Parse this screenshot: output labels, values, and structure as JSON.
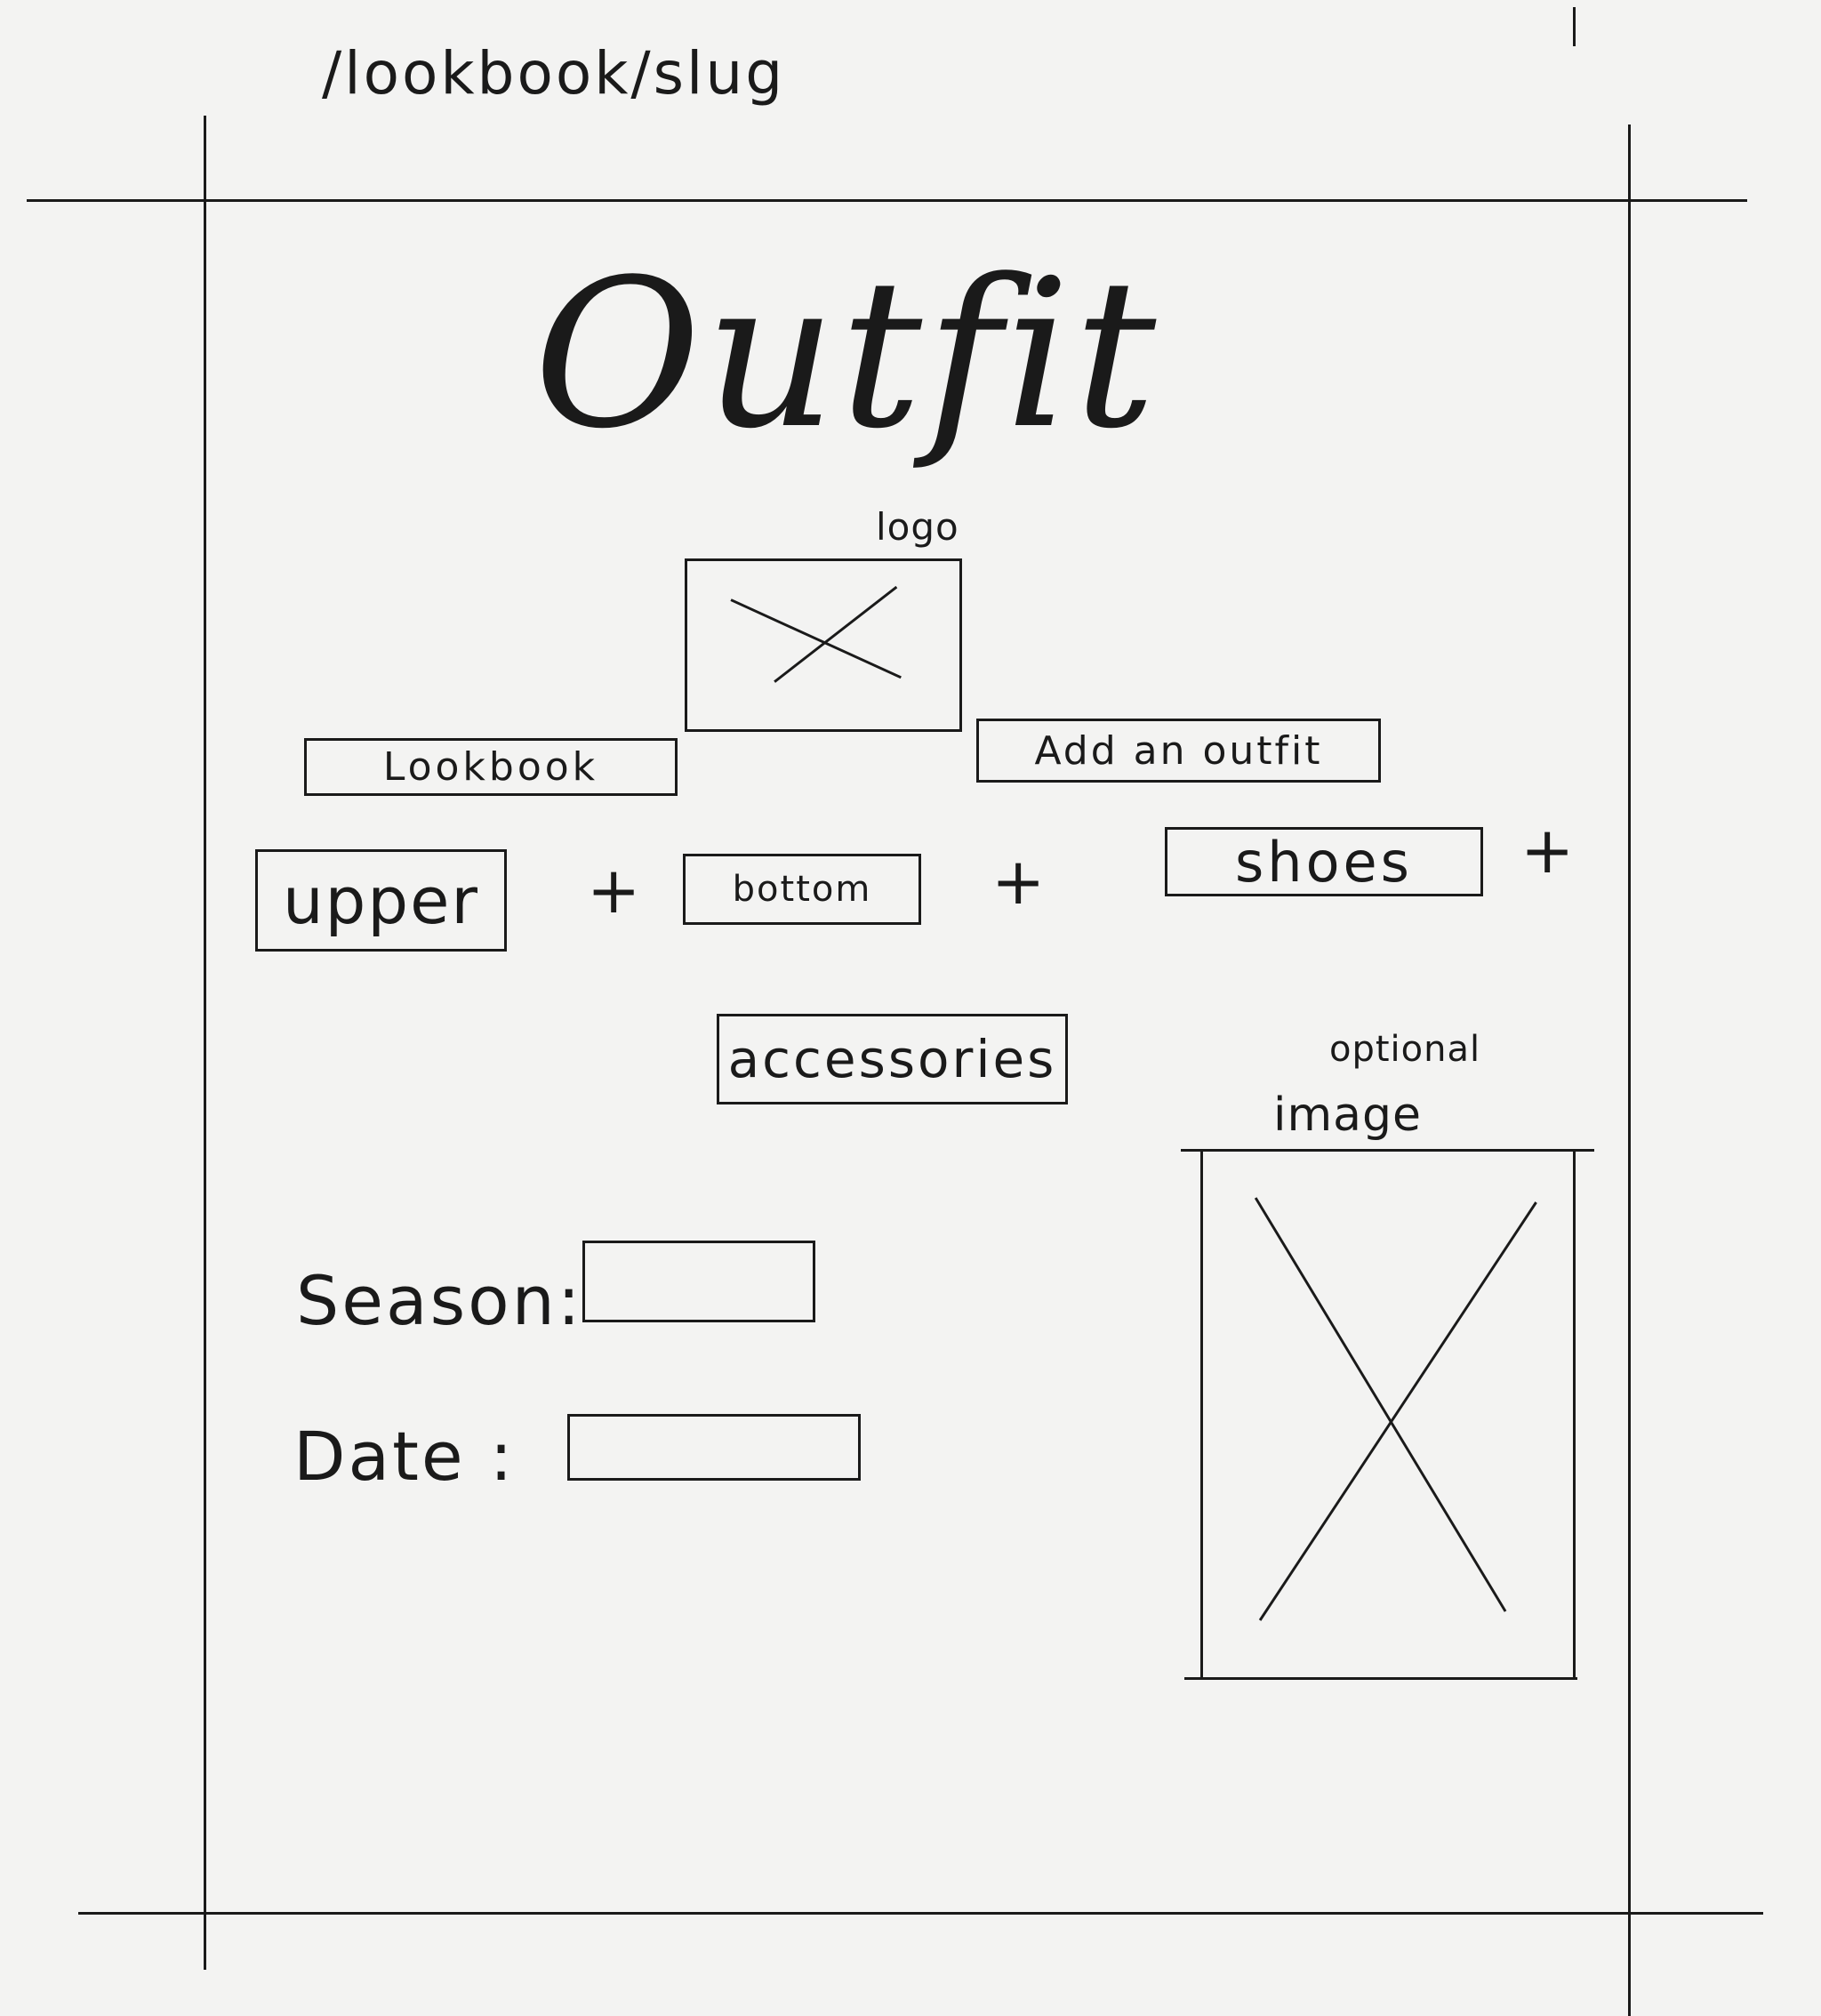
{
  "route": "/lookbook/slug",
  "title": "Outfit",
  "logo": {
    "label": "logo"
  },
  "buttons": {
    "lookbook": "Lookbook",
    "add_outfit": "Add an outfit"
  },
  "outfit_parts": {
    "upper": "upper",
    "bottom": "bottom",
    "shoes": "shoes",
    "accessories": "accessories",
    "plus": "+"
  },
  "image": {
    "note": "optional",
    "label": "image"
  },
  "form": {
    "season_label": "Season:",
    "date_label": "Date :"
  }
}
